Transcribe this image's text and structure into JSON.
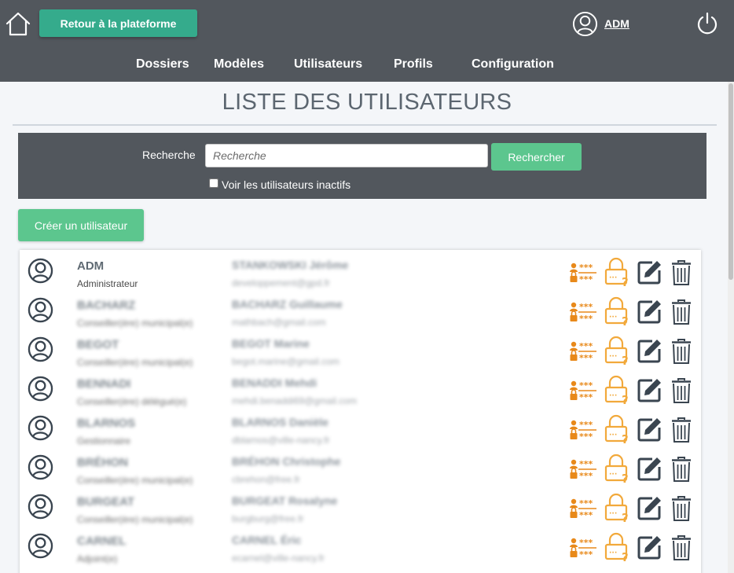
{
  "header": {
    "return_label": "Retour à la plateforme",
    "username": "ADM",
    "nav": [
      "Dossiers",
      "Modèles",
      "Utilisateurs",
      "Profils",
      "Configuration"
    ]
  },
  "page": {
    "title": "LISTE DES UTILISATEURS"
  },
  "search": {
    "label": "Recherche",
    "placeholder": "Recherche",
    "value": "",
    "button_label": "Rechercher",
    "inactive_label": "Voir les utilisateurs inactifs",
    "inactive_checked": false
  },
  "create_label": "Créer un utilisateur",
  "colors": {
    "header_bg": "#52575d",
    "return_button": "#35ab8c",
    "primary_button": "#5cc68e",
    "action_orange": "#e8891a",
    "lock_yellow": "#f2a93b",
    "icon_dark": "#3a4550"
  },
  "users": [
    {
      "login": "ADM",
      "role": "Administrateur",
      "fullname": "STANKOWSKI Jérôme",
      "email": "developpement@gpd.fr",
      "blurred": false
    },
    {
      "login": "BACHARZ",
      "role": "Conseiller(ère) municipal(e)",
      "fullname": "BACHARZ Guillaume",
      "email": "mathbach@gmail.com",
      "blurred": true
    },
    {
      "login": "BEGOT",
      "role": "Conseiller(ère) municipal(e)",
      "fullname": "BEGOT Marine",
      "email": "begot.marine@gmail.com",
      "blurred": true
    },
    {
      "login": "BENNADI",
      "role": "Conseiller(ère) délégué(e)",
      "fullname": "BENADDI Mehdi",
      "email": "mehdi.benaddi69@gmail.com",
      "blurred": true
    },
    {
      "login": "BLARNOS",
      "role": "Gestionnaire",
      "fullname": "BLARNOS Danièle",
      "email": "dblarnos@ville-nancy.fr",
      "blurred": true
    },
    {
      "login": "BRÉHON",
      "role": "Conseiller(ère) municipal(e)",
      "fullname": "BRÉHON Christophe",
      "email": "cbrehon@free.fr",
      "blurred": true
    },
    {
      "login": "BURGEAT",
      "role": "Conseiller(ère) municipal(e)",
      "fullname": "BURGEAT Rosalyne",
      "email": "burgburg@free.fr",
      "blurred": true
    },
    {
      "login": "CARNEL",
      "role": "Adjoint(e)",
      "fullname": "CARNEL Éric",
      "email": "ecarnel@ville-nancy.fr",
      "blurred": true
    }
  ],
  "icons": {
    "home": "home-icon",
    "user": "user-circle-icon",
    "power": "power-icon",
    "actions": [
      "user-password-icon",
      "lock-question-icon",
      "edit-icon",
      "trash-icon"
    ]
  }
}
